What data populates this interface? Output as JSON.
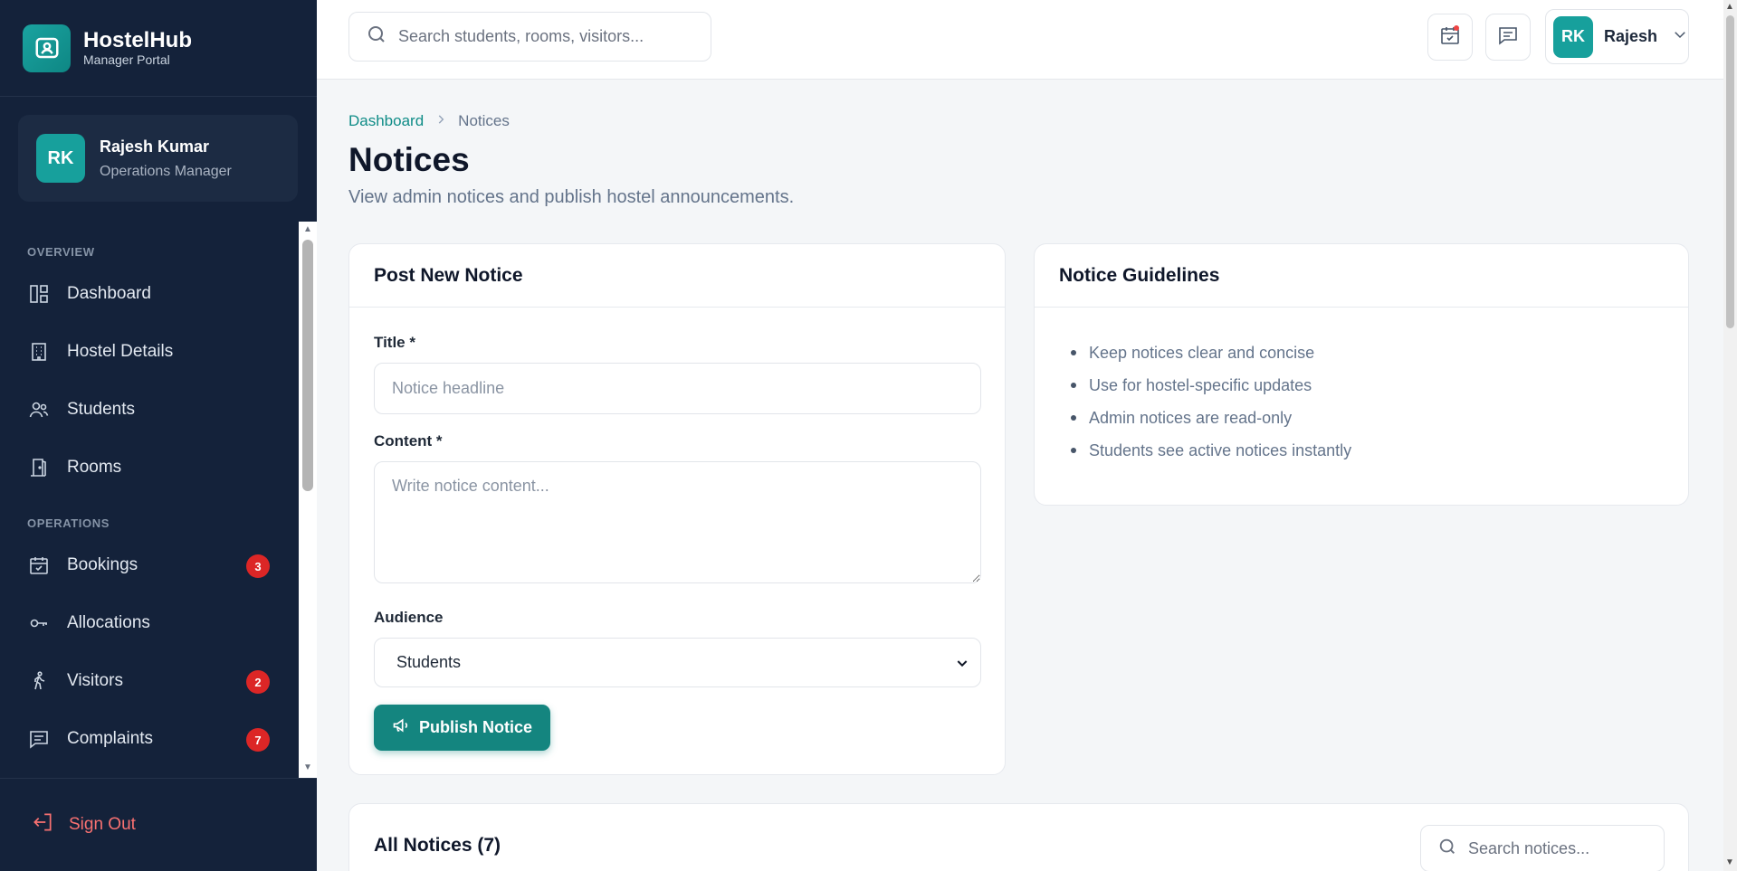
{
  "brand": {
    "name": "HostelHub",
    "subtitle": "Manager Portal"
  },
  "profile": {
    "initials": "RK",
    "name": "Rajesh Kumar",
    "role": "Operations Manager"
  },
  "nav": {
    "sections": [
      {
        "label": "OVERVIEW",
        "items": [
          {
            "label": "Dashboard",
            "icon": "dashboard-icon"
          },
          {
            "label": "Hostel Details",
            "icon": "building-icon"
          },
          {
            "label": "Students",
            "icon": "users-icon"
          },
          {
            "label": "Rooms",
            "icon": "door-icon"
          }
        ]
      },
      {
        "label": "OPERATIONS",
        "items": [
          {
            "label": "Bookings",
            "icon": "calendar-check-icon",
            "badge": "3"
          },
          {
            "label": "Allocations",
            "icon": "key-icon"
          },
          {
            "label": "Visitors",
            "icon": "walking-person-icon",
            "badge": "2"
          },
          {
            "label": "Complaints",
            "icon": "message-icon",
            "badge": "7"
          }
        ]
      }
    ]
  },
  "signout": {
    "label": "Sign Out"
  },
  "topbar": {
    "search_placeholder": "Search students, rooms, visitors...",
    "user_initials": "RK",
    "user_name": "Rajesh"
  },
  "breadcrumb": {
    "root": "Dashboard",
    "current": "Notices"
  },
  "page": {
    "title": "Notices",
    "subtitle": "View admin notices and publish hostel announcements."
  },
  "post_form": {
    "heading": "Post New Notice",
    "title_label": "Title *",
    "title_placeholder": "Notice headline",
    "content_label": "Content *",
    "content_placeholder": "Write notice content...",
    "audience_label": "Audience",
    "audience_value": "Students",
    "publish_label": "Publish Notice"
  },
  "guidelines": {
    "heading": "Notice Guidelines",
    "items": [
      "Keep notices clear and concise",
      "Use for hostel-specific updates",
      "Admin notices are read-only",
      "Students see active notices instantly"
    ]
  },
  "all_notices": {
    "heading": "All Notices (7)",
    "search_placeholder": "Search notices..."
  },
  "colors": {
    "sidebar_bg": "#14223a",
    "accent": "#14857f",
    "badge": "#dc2626",
    "signout": "#f87171"
  }
}
